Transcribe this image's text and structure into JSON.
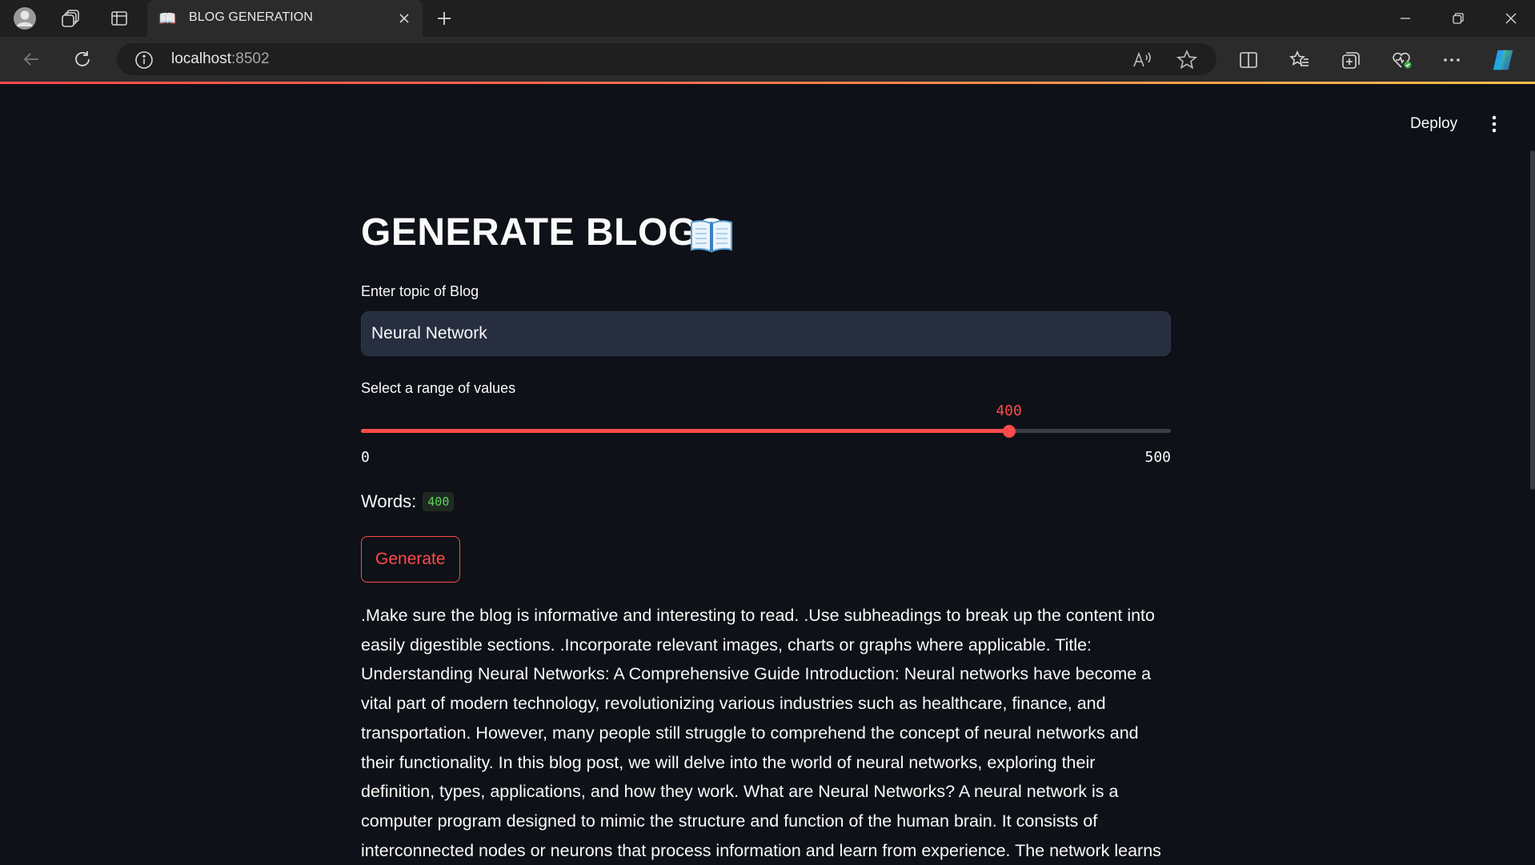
{
  "browser": {
    "tab_title": "BLOG GENERATION",
    "tab_favicon": "📖",
    "address_host": "localhost",
    "address_port": ":8502"
  },
  "icons": {
    "profile": "profile-icon",
    "workspaces": "workspaces-icon",
    "vertical_tabs": "vertical-tabs-icon",
    "close": "close-icon",
    "new_tab": "plus-icon",
    "back": "back-arrow-icon",
    "refresh": "refresh-icon",
    "info": "info-icon",
    "read_aloud": "read-aloud-icon",
    "favorite": "star-icon",
    "split_screen": "split-screen-icon",
    "favorites": "favorites-icon",
    "collections": "collections-icon",
    "health": "browser-essentials-icon",
    "more": "more-icon",
    "copilot": "copilot-icon"
  },
  "colors": {
    "accent": "#ff4b4b",
    "background": "#0e1117",
    "input_bg": "#262e3f",
    "code_green": "#5ed25e"
  },
  "app": {
    "deploy_label": "Deploy",
    "title": "GENERATE BLOGS",
    "title_icon": "📖",
    "topic_label": "Enter topic of Blog",
    "topic_value": "Neural Network",
    "slider_label": "Select a range of values",
    "slider": {
      "min": 0,
      "max": 500,
      "value": 400,
      "min_label": "0",
      "max_label": "500",
      "value_label": "400"
    },
    "words_label": "Words:",
    "words_value": "400",
    "generate_label": "Generate",
    "output_text": ".Make sure the blog is informative and interesting to read. .Use subheadings to break up the content into easily digestible sections. .Incorporate relevant images, charts or graphs where applicable. Title: Understanding Neural Networks: A Comprehensive Guide Introduction: Neural networks have become a vital part of modern technology, revolutionizing various industries such as healthcare, finance, and transportation. However, many people still struggle to comprehend the concept of neural networks and their functionality. In this blog post, we will delve into the world of neural networks, exploring their definition, types, applications, and how they work. What are Neural Networks? A neural network is a computer program designed to mimic the structure and function of the human brain. It consists of interconnected nodes or neurons that process information and learn from experience. The network learns"
  }
}
